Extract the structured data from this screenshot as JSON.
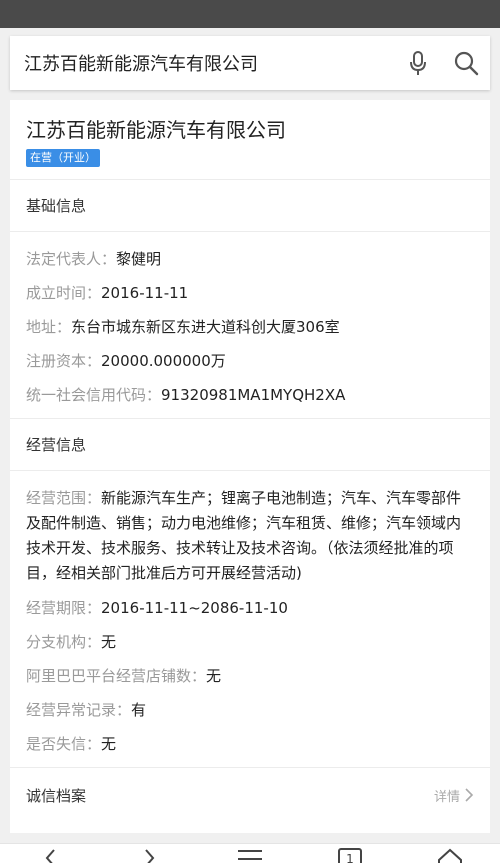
{
  "search": {
    "query": "江苏百能新能源汽车有限公司"
  },
  "company": {
    "name": "江苏百能新能源汽车有限公司",
    "status_badge": "在营（开业）"
  },
  "basic_info": {
    "title": "基础信息",
    "rows": [
      {
        "label": "法定代表人：",
        "value": "黎健明"
      },
      {
        "label": "成立时间：",
        "value": "2016-11-11"
      },
      {
        "label": "地址：",
        "value": "东台市城东新区东进大道科创大厦306室"
      },
      {
        "label": "注册资本：",
        "value": "20000.000000万"
      },
      {
        "label": "统一社会信用代码：",
        "value": "91320981MA1MYQH2XA"
      }
    ]
  },
  "business_info": {
    "title": "经营信息",
    "scope_label": "经营范围：",
    "scope_value": "新能源汽车生产；锂离子电池制造；汽车、汽车零部件及配件制造、销售；动力电池维修；汽车租赁、维修；汽车领域内技术开发、技术服务、技术转让及技术咨询。（依法须经批准的项目，经相关部门批准后方可开展经营活动)",
    "rows": [
      {
        "label": "经营期限：",
        "value": "2016-11-11~2086-11-10"
      },
      {
        "label": "分支机构：",
        "value": "无"
      },
      {
        "label": "阿里巴巴平台经营店铺数：",
        "value": "无"
      },
      {
        "label": "经营异常记录：",
        "value": "有"
      },
      {
        "label": "是否失信：",
        "value": "无"
      }
    ]
  },
  "credit": {
    "title": "诚信档案",
    "detail_label": "详情"
  },
  "nav": {
    "tab_count": "1"
  }
}
